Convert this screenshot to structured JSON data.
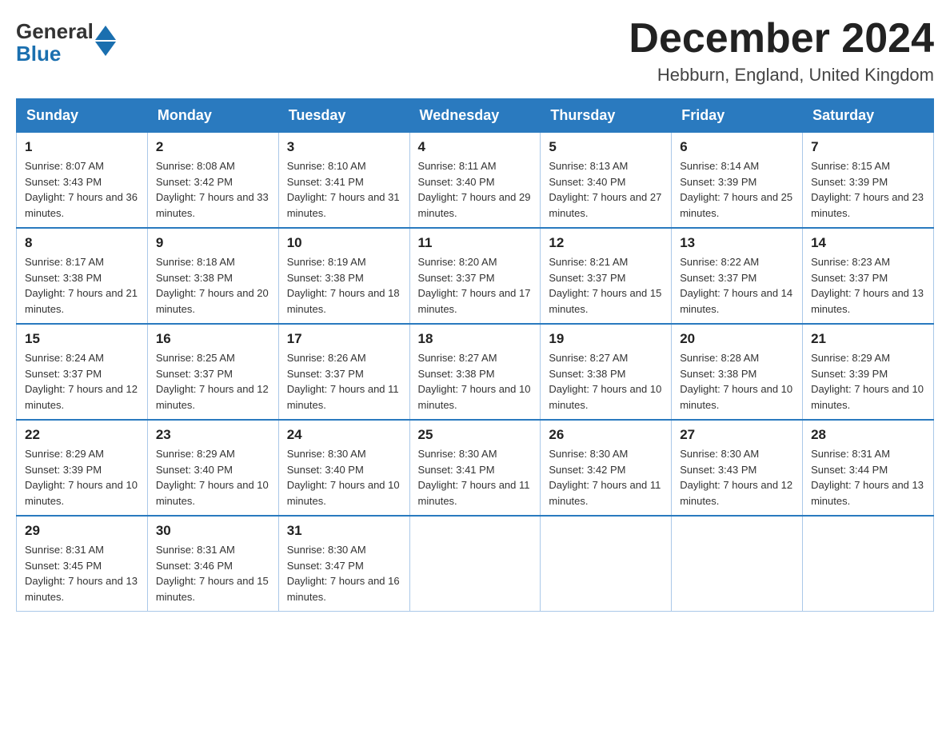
{
  "header": {
    "logo_line1": "General",
    "logo_line2": "Blue",
    "month_title": "December 2024",
    "location": "Hebburn, England, United Kingdom"
  },
  "weekdays": [
    "Sunday",
    "Monday",
    "Tuesday",
    "Wednesday",
    "Thursday",
    "Friday",
    "Saturday"
  ],
  "weeks": [
    [
      {
        "day": "1",
        "sunrise": "8:07 AM",
        "sunset": "3:43 PM",
        "daylight": "7 hours and 36 minutes."
      },
      {
        "day": "2",
        "sunrise": "8:08 AM",
        "sunset": "3:42 PM",
        "daylight": "7 hours and 33 minutes."
      },
      {
        "day": "3",
        "sunrise": "8:10 AM",
        "sunset": "3:41 PM",
        "daylight": "7 hours and 31 minutes."
      },
      {
        "day": "4",
        "sunrise": "8:11 AM",
        "sunset": "3:40 PM",
        "daylight": "7 hours and 29 minutes."
      },
      {
        "day": "5",
        "sunrise": "8:13 AM",
        "sunset": "3:40 PM",
        "daylight": "7 hours and 27 minutes."
      },
      {
        "day": "6",
        "sunrise": "8:14 AM",
        "sunset": "3:39 PM",
        "daylight": "7 hours and 25 minutes."
      },
      {
        "day": "7",
        "sunrise": "8:15 AM",
        "sunset": "3:39 PM",
        "daylight": "7 hours and 23 minutes."
      }
    ],
    [
      {
        "day": "8",
        "sunrise": "8:17 AM",
        "sunset": "3:38 PM",
        "daylight": "7 hours and 21 minutes."
      },
      {
        "day": "9",
        "sunrise": "8:18 AM",
        "sunset": "3:38 PM",
        "daylight": "7 hours and 20 minutes."
      },
      {
        "day": "10",
        "sunrise": "8:19 AM",
        "sunset": "3:38 PM",
        "daylight": "7 hours and 18 minutes."
      },
      {
        "day": "11",
        "sunrise": "8:20 AM",
        "sunset": "3:37 PM",
        "daylight": "7 hours and 17 minutes."
      },
      {
        "day": "12",
        "sunrise": "8:21 AM",
        "sunset": "3:37 PM",
        "daylight": "7 hours and 15 minutes."
      },
      {
        "day": "13",
        "sunrise": "8:22 AM",
        "sunset": "3:37 PM",
        "daylight": "7 hours and 14 minutes."
      },
      {
        "day": "14",
        "sunrise": "8:23 AM",
        "sunset": "3:37 PM",
        "daylight": "7 hours and 13 minutes."
      }
    ],
    [
      {
        "day": "15",
        "sunrise": "8:24 AM",
        "sunset": "3:37 PM",
        "daylight": "7 hours and 12 minutes."
      },
      {
        "day": "16",
        "sunrise": "8:25 AM",
        "sunset": "3:37 PM",
        "daylight": "7 hours and 12 minutes."
      },
      {
        "day": "17",
        "sunrise": "8:26 AM",
        "sunset": "3:37 PM",
        "daylight": "7 hours and 11 minutes."
      },
      {
        "day": "18",
        "sunrise": "8:27 AM",
        "sunset": "3:38 PM",
        "daylight": "7 hours and 10 minutes."
      },
      {
        "day": "19",
        "sunrise": "8:27 AM",
        "sunset": "3:38 PM",
        "daylight": "7 hours and 10 minutes."
      },
      {
        "day": "20",
        "sunrise": "8:28 AM",
        "sunset": "3:38 PM",
        "daylight": "7 hours and 10 minutes."
      },
      {
        "day": "21",
        "sunrise": "8:29 AM",
        "sunset": "3:39 PM",
        "daylight": "7 hours and 10 minutes."
      }
    ],
    [
      {
        "day": "22",
        "sunrise": "8:29 AM",
        "sunset": "3:39 PM",
        "daylight": "7 hours and 10 minutes."
      },
      {
        "day": "23",
        "sunrise": "8:29 AM",
        "sunset": "3:40 PM",
        "daylight": "7 hours and 10 minutes."
      },
      {
        "day": "24",
        "sunrise": "8:30 AM",
        "sunset": "3:40 PM",
        "daylight": "7 hours and 10 minutes."
      },
      {
        "day": "25",
        "sunrise": "8:30 AM",
        "sunset": "3:41 PM",
        "daylight": "7 hours and 11 minutes."
      },
      {
        "day": "26",
        "sunrise": "8:30 AM",
        "sunset": "3:42 PM",
        "daylight": "7 hours and 11 minutes."
      },
      {
        "day": "27",
        "sunrise": "8:30 AM",
        "sunset": "3:43 PM",
        "daylight": "7 hours and 12 minutes."
      },
      {
        "day": "28",
        "sunrise": "8:31 AM",
        "sunset": "3:44 PM",
        "daylight": "7 hours and 13 minutes."
      }
    ],
    [
      {
        "day": "29",
        "sunrise": "8:31 AM",
        "sunset": "3:45 PM",
        "daylight": "7 hours and 13 minutes."
      },
      {
        "day": "30",
        "sunrise": "8:31 AM",
        "sunset": "3:46 PM",
        "daylight": "7 hours and 15 minutes."
      },
      {
        "day": "31",
        "sunrise": "8:30 AM",
        "sunset": "3:47 PM",
        "daylight": "7 hours and 16 minutes."
      },
      null,
      null,
      null,
      null
    ]
  ]
}
